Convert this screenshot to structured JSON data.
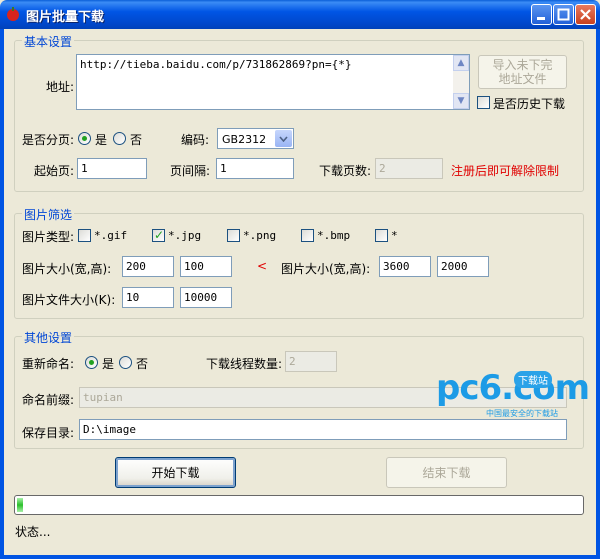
{
  "window": {
    "title": "图片批量下载"
  },
  "basic": {
    "group_title": "基本设置",
    "address_label": "地址:",
    "address_value": "http://tieba.baidu.com/p/731862869?pn={*}",
    "import_button": "导入未下完\n地址文件",
    "history_label": "是否历史下载",
    "paging_label": "是否分页:",
    "yes": "是",
    "no": "否",
    "encoding_label": "编码:",
    "encoding_value": "GB2312",
    "start_page_label": "起始页:",
    "start_page_value": "1",
    "interval_label": "页间隔:",
    "interval_value": "1",
    "download_pages_label": "下载页数:",
    "download_pages_value": "2",
    "register_notice": "注册后即可解除限制"
  },
  "filter": {
    "group_title": "图片筛选",
    "type_label": "图片类型:",
    "types": [
      {
        "label": "*.gif",
        "checked": false
      },
      {
        "label": "*.jpg",
        "checked": true
      },
      {
        "label": "*.png",
        "checked": false
      },
      {
        "label": "*.bmp",
        "checked": false
      },
      {
        "label": "*",
        "checked": false
      }
    ],
    "size_label": "图片大小(宽,高):",
    "min_width": "200",
    "min_height": "100",
    "lt_symbol": "<",
    "size_label_max": "图片大小(宽,高):",
    "max_width": "3600",
    "max_height": "2000",
    "filesize_label": "图片文件大小(K):",
    "min_filesize": "10",
    "max_filesize": "10000"
  },
  "other": {
    "group_title": "其他设置",
    "rename_label": "重新命名:",
    "yes": "是",
    "no": "否",
    "threads_label": "下载线程数量:",
    "threads_value": "2",
    "prefix_label": "命名前缀:",
    "prefix_value": "tupian",
    "save_dir_label": "保存目录:",
    "save_dir_value": "D:\\image"
  },
  "actions": {
    "start": "开始下载",
    "stop": "结束下载"
  },
  "progress": {
    "fraction": 0.02
  },
  "status": {
    "text": "状态..."
  },
  "watermark": {
    "logo": "pc6.com",
    "badge": "下载站",
    "tagline": "中国最安全的下载站"
  },
  "colors": {
    "accent": "#0046D5",
    "notice": "#E00000",
    "check": "#21A121"
  }
}
